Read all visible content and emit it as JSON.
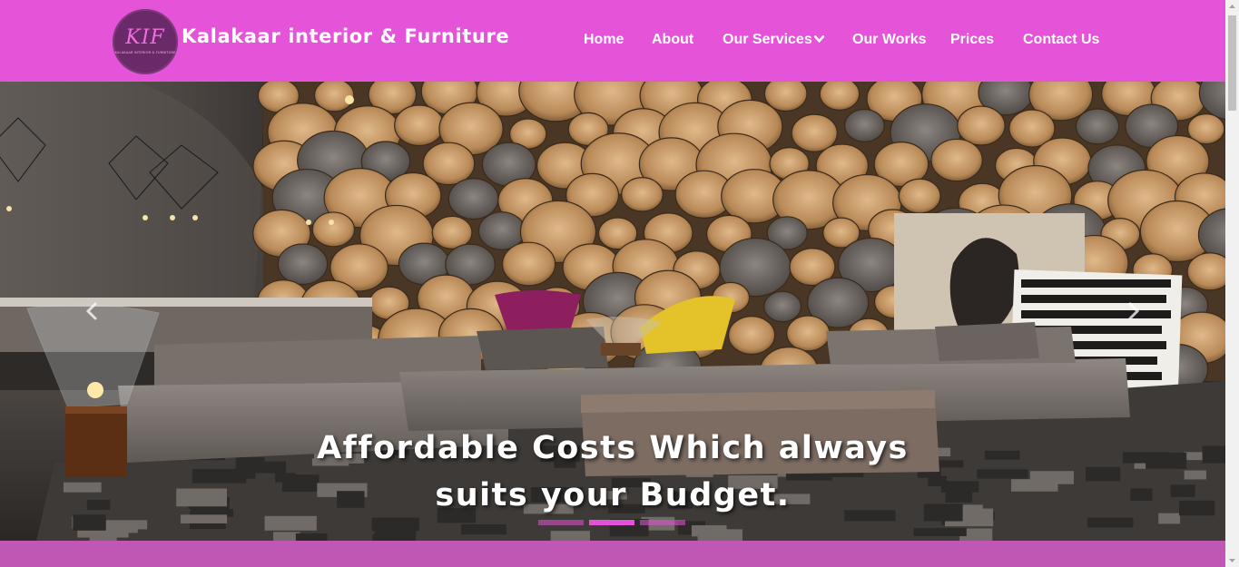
{
  "brand": {
    "logo_monogram": "KIF",
    "logo_tagline": "KALAKAAR INTERIOR & FURNITURE",
    "name": "Kalakaar interior & Furniture"
  },
  "nav": {
    "items": [
      {
        "label": "Home"
      },
      {
        "label": "About"
      },
      {
        "label": "Our Services",
        "has_dropdown": true
      },
      {
        "label": "Our Works"
      },
      {
        "label": "Prices"
      },
      {
        "label": "Contact Us"
      }
    ]
  },
  "hero": {
    "caption": "Affordable Costs Which always suits your Budget.",
    "prev_icon": "chevron-left-icon",
    "next_icon": "chevron-right-icon",
    "slide_count": 3,
    "active_slide": 2
  },
  "colors": {
    "header_bg": "#e453d8",
    "accent": "#e352d6",
    "bottom_strip": "#c057b4"
  }
}
